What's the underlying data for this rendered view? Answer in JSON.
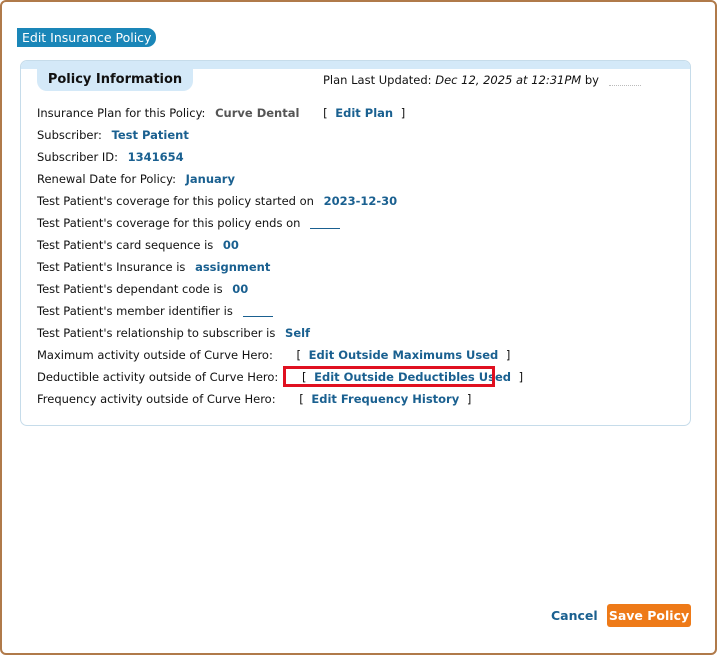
{
  "dialog": {
    "title": "Edit Insurance Policy"
  },
  "panel": {
    "tab_label": "Policy Information",
    "plan_updated_label": "Plan Last Updated:",
    "plan_updated_value": "Dec 12, 2025 at 12:31PM",
    "plan_updated_by": "by"
  },
  "fields": {
    "insurance_plan_label": "Insurance Plan for this Policy:",
    "insurance_plan_value": "Curve Dental",
    "edit_plan_label": "Edit Plan",
    "subscriber_label": "Subscriber:",
    "subscriber_value": "Test Patient",
    "subscriber_id_label": "Subscriber ID:",
    "subscriber_id_value": "1341654",
    "renewal_label": "Renewal Date for Policy:",
    "renewal_value": "January",
    "coverage_start_label": "Test Patient's coverage for this policy started on",
    "coverage_start_value": "2023-12-30",
    "coverage_end_label": "Test Patient's coverage for this policy ends on",
    "card_sequence_label": "Test Patient's card sequence is",
    "card_sequence_value": "00",
    "insurance_label": "Test Patient's Insurance is",
    "insurance_value": "assignment",
    "dependant_code_label": "Test Patient's dependant code is",
    "dependant_code_value": "00",
    "member_identifier_label": "Test Patient's member identifier is",
    "relationship_label": "Test Patient's relationship to subscriber is",
    "relationship_value": "Self",
    "max_activity_label": "Maximum activity outside of Curve Hero:",
    "max_activity_link": "Edit Outside Maximums Used",
    "deductible_activity_label": "Deductible activity outside of Curve Hero:",
    "deductible_activity_link": "Edit Outside Deductibles Used",
    "frequency_activity_label": "Frequency activity outside of Curve Hero:",
    "frequency_activity_link": "Edit Frequency History",
    "bracket_open": "[",
    "bracket_close": "]"
  },
  "footer": {
    "cancel_label": "Cancel",
    "save_label": "Save Policy"
  },
  "colors": {
    "accent_blue": "#1a86b8",
    "link_blue": "#1a6090",
    "save_orange": "#ee7a18",
    "highlight_red": "#e01020"
  }
}
